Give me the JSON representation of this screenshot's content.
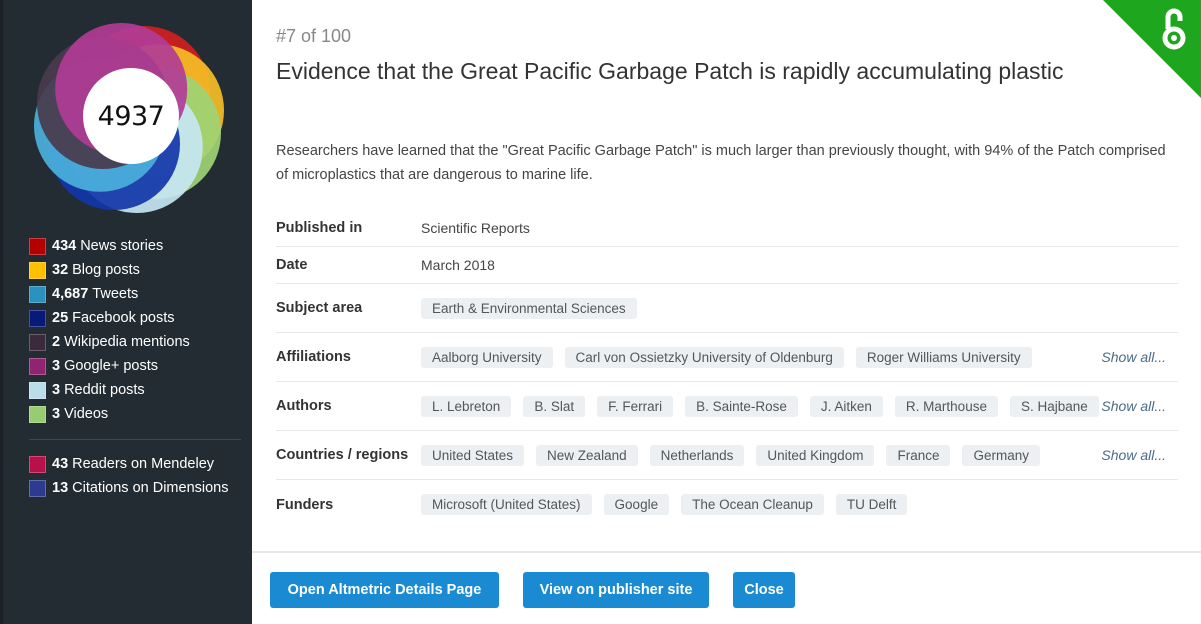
{
  "sidebar": {
    "score": "4937",
    "attention": [
      {
        "count": "434",
        "label": "News stories",
        "color": "#b60000"
      },
      {
        "count": "32",
        "label": "Blog posts",
        "color": "#ffc000"
      },
      {
        "count": "4,687",
        "label": "Tweets",
        "color": "#2a92be"
      },
      {
        "count": "25",
        "label": "Facebook posts",
        "color": "#071a7a"
      },
      {
        "count": "2",
        "label": "Wikipedia mentions",
        "color": "#3b2a3d"
      },
      {
        "count": "3",
        "label": "Google+ posts",
        "color": "#912470"
      },
      {
        "count": "3",
        "label": "Reddit posts",
        "color": "#b9ddeb"
      },
      {
        "count": "3",
        "label": "Videos",
        "color": "#98cc70"
      }
    ],
    "readers": [
      {
        "count": "43",
        "label": "Readers on Mendeley",
        "color": "#b8114a"
      },
      {
        "count": "13",
        "label": "Citations on Dimensions",
        "color": "#2c3b8f"
      }
    ],
    "donut_segments": [
      {
        "name": "news",
        "color": "#d11f1f"
      },
      {
        "name": "blogs",
        "color": "#f6be26"
      },
      {
        "name": "videos",
        "color": "#9ed374"
      },
      {
        "name": "reddit",
        "color": "#c7e6f2"
      },
      {
        "name": "facebook",
        "color": "#1236a8"
      },
      {
        "name": "tweets",
        "color": "#4bb0dc"
      },
      {
        "name": "wikipedia",
        "color": "#4a3b4d"
      },
      {
        "name": "google",
        "color": "#b13c95"
      }
    ]
  },
  "main": {
    "rank": "#7 of 100",
    "title": "Evidence that the Great Pacific Garbage Patch is rapidly accumulating plastic",
    "summary": "Researchers have learned that the \"Great Pacific Garbage Patch\" is much larger than previously thought, with 94% of the Patch comprised of microplastics that are dangerous to marine life.",
    "published_in": {
      "label": "Published in",
      "value": "Scientific Reports"
    },
    "date": {
      "label": "Date",
      "value": "March 2018"
    },
    "subject_area": {
      "label": "Subject area",
      "tags": [
        "Earth & Environmental Sciences"
      ]
    },
    "affiliations": {
      "label": "Affiliations",
      "tags": [
        "Aalborg University",
        "Carl von Ossietzky University of Oldenburg",
        "Roger Williams University"
      ],
      "show_all": "Show all..."
    },
    "authors": {
      "label": "Authors",
      "tags": [
        "L. Lebreton",
        "B. Slat",
        "F. Ferrari",
        "B. Sainte-Rose",
        "J. Aitken",
        "R. Marthouse",
        "S. Hajbane"
      ],
      "show_all": "Show all..."
    },
    "countries": {
      "label": "Countries / regions",
      "tags": [
        "United States",
        "New Zealand",
        "Netherlands",
        "United Kingdom",
        "France",
        "Germany"
      ],
      "show_all": "Show all..."
    },
    "funders": {
      "label": "Funders",
      "tags": [
        "Microsoft (United States)",
        "Google",
        "The Ocean Cleanup",
        "TU Delft"
      ]
    }
  },
  "footer": {
    "details_button": "Open Altmetric Details Page",
    "publisher_button": "View on publisher site",
    "close_button": "Close"
  },
  "colors": {
    "accent": "#1a8bd3",
    "sidebar_bg": "#242c33",
    "open_access": "#1fa61f"
  }
}
